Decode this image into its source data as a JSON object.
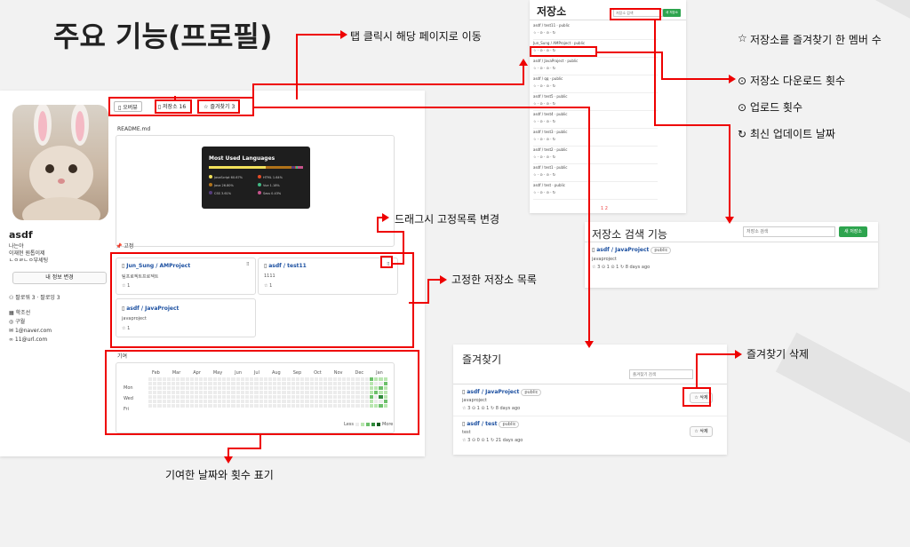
{
  "slide": {
    "title": "주요 기능(프로필)"
  },
  "callouts": {
    "tab_click": "탭 클릭시 해당 페이지로 이동",
    "drag": "드래그시 고정목록 변경",
    "pinned": "고정한 저장소 목록",
    "contrib": "기여한 날짜와 횟수 표기",
    "fav_delete": "즐겨찾기 삭제"
  },
  "features": [
    {
      "icon": "star-icon",
      "glyph": "☆",
      "text": "저장소를 즐겨찾기 한 멤버 수"
    },
    {
      "icon": "download-icon",
      "glyph": "⊙",
      "text": "저장소 다운로드 횟수"
    },
    {
      "icon": "upload-icon",
      "glyph": "⊙",
      "text": "업로드 횟수"
    },
    {
      "icon": "refresh-icon",
      "glyph": "↻",
      "text": "최신 업데이트 날짜"
    }
  ],
  "profile": {
    "name": "asdf",
    "bio_lines": [
      "나는야",
      "이재현 원톱이제",
      "ㄴㅇㄹㄴㅇ부세팅"
    ],
    "edit_button": "내 정보 변경",
    "follow": "팔로워 3 · 팔로잉 3",
    "org": "학조선",
    "location": "구월",
    "email": "1@naver.com",
    "link": "11@url.com"
  },
  "tabs": [
    {
      "glyph": "▯",
      "label": "오버뷰",
      "count": ""
    },
    {
      "glyph": "▯",
      "label": "저장소",
      "count": "16"
    },
    {
      "glyph": "☆",
      "label": "즐겨찾기",
      "count": "3"
    }
  ],
  "readme": {
    "file": "README.md",
    "card_title": "Most Used Languages",
    "languages": [
      {
        "name": "JavaScript 60.67%",
        "color": "#f1e05a"
      },
      {
        "name": "HTML 1.64%",
        "color": "#e34c26"
      },
      {
        "name": "Java 26.80%",
        "color": "#b07219"
      },
      {
        "name": "Vue 1.18%",
        "color": "#41b883"
      },
      {
        "name": "CSS 3.61%",
        "color": "#563d7c"
      },
      {
        "name": "Sass 0.43%",
        "color": "#c6538c"
      }
    ]
  },
  "pinned": {
    "label": "고정",
    "items": [
      {
        "title": "Jun_Sung / AMProject",
        "desc": "팀프로젝트프로젝트",
        "stars": "1"
      },
      {
        "title": "asdf / test11",
        "desc": "1111",
        "stars": "1"
      },
      {
        "title": "asdf / JavaProject",
        "desc": "javaproject",
        "stars": "1"
      }
    ]
  },
  "contrib": {
    "label": "기여",
    "months": [
      "Feb",
      "Mar",
      "Apr",
      "May",
      "Jun",
      "Jul",
      "Aug",
      "Sep",
      "Oct",
      "Nov",
      "Dec",
      "Jan"
    ],
    "days": [
      "Mon",
      "Wed",
      "Fri"
    ],
    "less": "Less",
    "more": "More"
  },
  "repo_panel": {
    "title": "저장소",
    "search_placeholder": "저장소 검색",
    "new_button": "새 저장소",
    "rows": [
      "asdf / test11 · public",
      "Jun_Sung / AMProject · public",
      "asdf / JavaProject · public",
      "asdf / qq · public",
      "asdf / test5 · public",
      "asdf / test4 · public",
      "asdf / test3 · public",
      "asdf / test2 · public",
      "asdf / test1 · public",
      "asdf / test · public"
    ],
    "pager": "1 2"
  },
  "repo_search": {
    "title": "저장소 검색 기능",
    "placeholder": "저장소 검색",
    "new_button": "새 저장소",
    "repo_title": "asdf / JavaProject",
    "badge": "public",
    "desc": "javaproject",
    "meta": "☆ 3   ⊙ 1   ⊙ 1   ↻ 8 days ago"
  },
  "fav_panel": {
    "title": "즐겨찾기",
    "placeholder": "즐겨찾기 검색",
    "items": [
      {
        "title": "asdf / JavaProject",
        "badge": "public",
        "desc": "javaproject",
        "meta": "☆ 3   ⊙ 1   ⊙ 1   ↻ 8 days ago",
        "button": "☆ 삭제"
      },
      {
        "title": "asdf / test",
        "badge": "public",
        "desc": "test",
        "meta": "☆ 3   ⊙ 0   ⊙ 1   ↻ 21 days ago",
        "button": "☆ 삭제"
      }
    ]
  }
}
